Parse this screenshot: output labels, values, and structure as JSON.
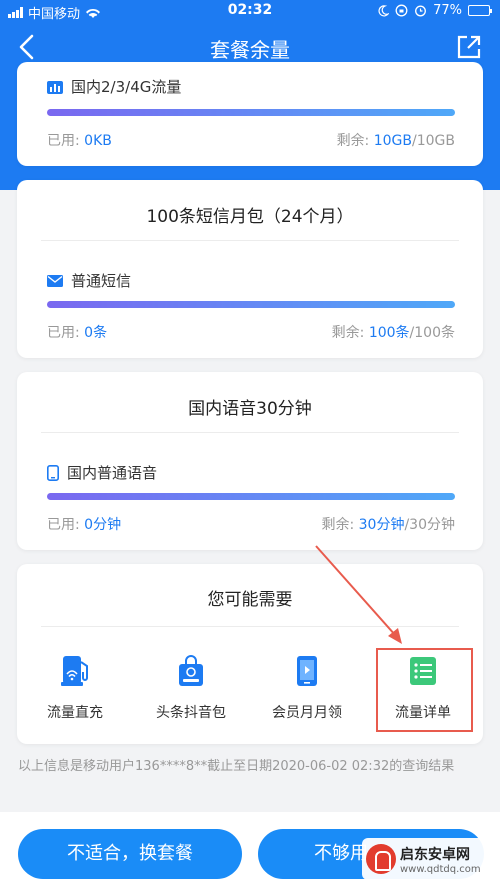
{
  "status": {
    "carrier": "中国移动",
    "time": "02:32",
    "battery": "77%",
    "battery_level": 0.77
  },
  "nav": {
    "title": "套餐余量"
  },
  "data_card": {
    "item_label": "国内2/3/4G流量",
    "used_label": "已用: ",
    "used_value": "0KB",
    "remain_label": "剩余: ",
    "remain_value": "10GB",
    "total": "/10GB"
  },
  "sms_card": {
    "title": "100条短信月包（24个月）",
    "item_label": "普通短信",
    "used_label": "已用: ",
    "used_value": "0条",
    "remain_label": "剩余: ",
    "remain_value": "100条",
    "total": "/100条"
  },
  "voice_card": {
    "title": "国内语音30分钟",
    "item_label": "国内普通语音",
    "used_label": "已用: ",
    "used_value": "0分钟",
    "remain_label": "剩余: ",
    "remain_value": "30分钟",
    "total": "/30分钟"
  },
  "recommend": {
    "title": "您可能需要",
    "items": [
      {
        "label": "流量直充",
        "icon": "gas-pump-icon"
      },
      {
        "label": "头条抖音包",
        "icon": "shopping-bag-icon"
      },
      {
        "label": "会员月月领",
        "icon": "phone-play-icon"
      },
      {
        "label": "流量详单",
        "icon": "list-icon"
      }
    ]
  },
  "footnote": "以上信息是移动用户136****8**截止至日期2020-06-02 02:32的查询结果",
  "buttons": {
    "change_plan": "不适合，换套餐",
    "not_enough": "不够用"
  },
  "watermark": {
    "name": "启东安卓网",
    "url": "www.qdtdq.com"
  },
  "colors": {
    "primary": "#1d7bf2",
    "button": "#1a8cf7",
    "highlight": "#e85b4d",
    "bar_start": "#7a68f0",
    "bar_end": "#4fa8f8"
  }
}
